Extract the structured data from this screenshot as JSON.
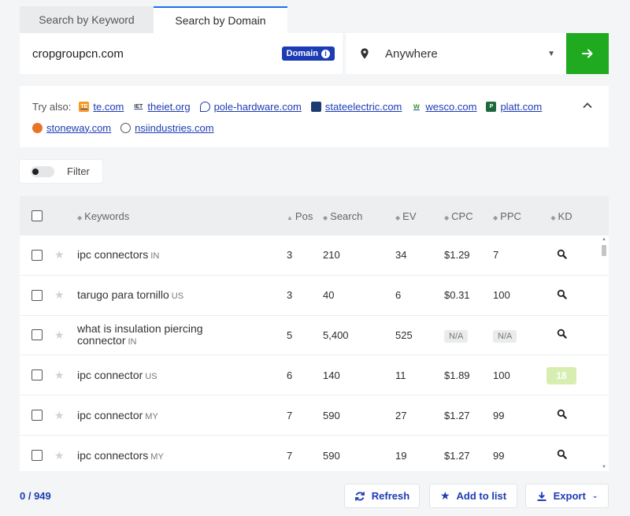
{
  "tabs": [
    {
      "label": "Search by Keyword",
      "active": false
    },
    {
      "label": "Search by Domain",
      "active": true
    }
  ],
  "search": {
    "domain_value": "cropgroupcn.com",
    "domain_badge": "Domain",
    "location": "Anywhere",
    "go_icon": "arrow-right-icon",
    "accent_color": "#1faa1f"
  },
  "try_also": {
    "label": "Try also:",
    "links": [
      {
        "text": "te.com",
        "icon": "te-favicon"
      },
      {
        "text": "theiet.org",
        "icon": "iet-favicon"
      },
      {
        "text": "pole-hardware.com",
        "icon": "pole-hardware-favicon"
      },
      {
        "text": "stateelectric.com",
        "icon": "stateelectric-favicon"
      },
      {
        "text": "wesco.com",
        "icon": "wesco-favicon"
      },
      {
        "text": "platt.com",
        "icon": "platt-favicon"
      },
      {
        "text": "stoneway.com",
        "icon": "stoneway-favicon"
      },
      {
        "text": "nsiindustries.com",
        "icon": "nsi-favicon"
      }
    ]
  },
  "filter": {
    "label": "Filter"
  },
  "table": {
    "headers": {
      "keywords": "Keywords",
      "pos": "Pos",
      "search": "Search",
      "ev": "EV",
      "cpc": "CPC",
      "ppc": "PPC",
      "kd": "KD"
    },
    "rows": [
      {
        "keyword": "ipc connectors",
        "cc": "IN",
        "pos": "3",
        "search": "210",
        "ev": "34",
        "cpc": "$1.29",
        "ppc": "7",
        "kd": ""
      },
      {
        "keyword": "tarugo para tornillo",
        "cc": "US",
        "pos": "3",
        "search": "40",
        "ev": "6",
        "cpc": "$0.31",
        "ppc": "100",
        "kd": ""
      },
      {
        "keyword": "what is insulation piercing connector",
        "cc": "IN",
        "pos": "5",
        "search": "5,400",
        "ev": "525",
        "cpc": "N/A",
        "ppc": "N/A",
        "kd": ""
      },
      {
        "keyword": "ipc connector",
        "cc": "US",
        "pos": "6",
        "search": "140",
        "ev": "11",
        "cpc": "$1.89",
        "ppc": "100",
        "kd": "18"
      },
      {
        "keyword": "ipc connector",
        "cc": "MY",
        "pos": "7",
        "search": "590",
        "ev": "27",
        "cpc": "$1.27",
        "ppc": "99",
        "kd": ""
      },
      {
        "keyword": "ipc connectors",
        "cc": "MY",
        "pos": "7",
        "search": "590",
        "ev": "19",
        "cpc": "$1.27",
        "ppc": "99",
        "kd": ""
      }
    ]
  },
  "footer": {
    "selected": "0",
    "total": "949",
    "refresh_label": "Refresh",
    "add_to_list_label": "Add to list",
    "export_label": "Export"
  }
}
